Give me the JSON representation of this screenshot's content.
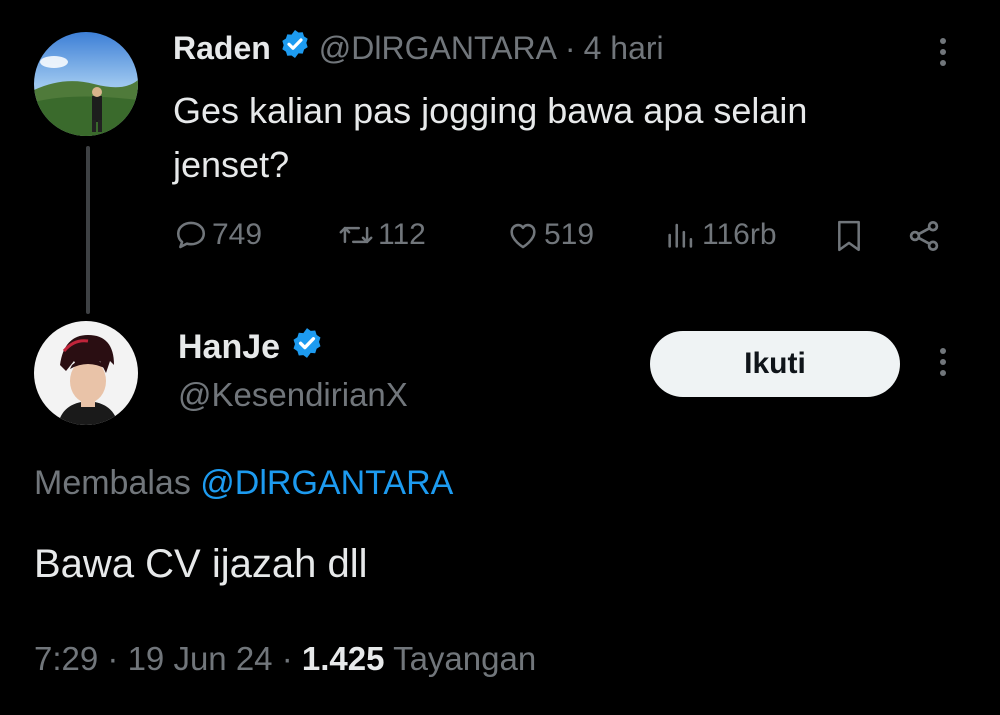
{
  "tweet_parent": {
    "author_name": "Raden",
    "handle": "@DlRGANTARA",
    "separator": "·",
    "time": "4 hari",
    "text_line1": "Ges kalian pas jogging bawa apa selain",
    "text_line2": "jenset?",
    "actions": {
      "replies": "749",
      "retweets": "112",
      "likes": "519",
      "views": "116rb"
    }
  },
  "tweet_reply": {
    "author_name": "HanJe",
    "handle": "@KesendirianX",
    "follow_label": "Ikuti",
    "replying_prefix": "Membalas",
    "replying_to": "@DlRGANTARA",
    "text": "Bawa CV ijazah dll",
    "time": "7:29",
    "date": "19 Jun 24",
    "views_count": "1.425",
    "views_label": "Tayangan",
    "separator": "·"
  },
  "colors": {
    "background": "#000000",
    "text": "#e7e9ea",
    "muted": "#71767b",
    "accent": "#1d9bf0",
    "button_bg": "#eff3f4"
  },
  "icons": [
    "verified-badge-icon",
    "more-options-icon",
    "reply-icon",
    "retweet-icon",
    "like-icon",
    "views-icon",
    "bookmark-icon",
    "share-icon"
  ]
}
